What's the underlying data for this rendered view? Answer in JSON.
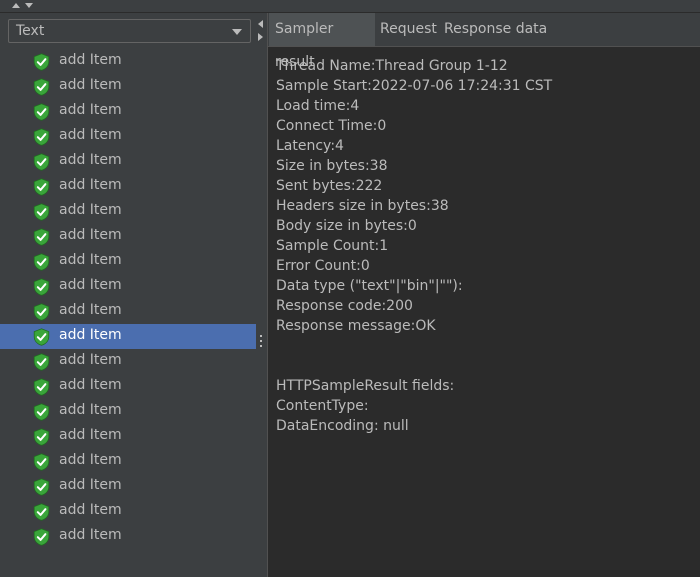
{
  "view_select": {
    "value": "Text"
  },
  "tree": {
    "items": [
      {
        "label": "add Item"
      },
      {
        "label": "add Item"
      },
      {
        "label": "add Item"
      },
      {
        "label": "add Item"
      },
      {
        "label": "add Item"
      },
      {
        "label": "add Item"
      },
      {
        "label": "add Item"
      },
      {
        "label": "add Item"
      },
      {
        "label": "add Item"
      },
      {
        "label": "add Item"
      },
      {
        "label": "add Item"
      },
      {
        "label": "add Item",
        "selected": true
      },
      {
        "label": "add Item"
      },
      {
        "label": "add Item"
      },
      {
        "label": "add Item"
      },
      {
        "label": "add Item"
      },
      {
        "label": "add Item"
      },
      {
        "label": "add Item"
      },
      {
        "label": "add Item"
      },
      {
        "label": "add Item"
      }
    ],
    "icon": "shield-check-icon"
  },
  "tabs": [
    {
      "label": "Sampler result",
      "active": true
    },
    {
      "label": "Request",
      "active": false
    },
    {
      "label": "Response data",
      "active": false
    }
  ],
  "sampler_result": {
    "lines": [
      "Thread Name:Thread Group 1-12",
      "Sample Start:2022-07-06 17:24:31 CST",
      "Load time:4",
      "Connect Time:0",
      "Latency:4",
      "Size in bytes:38",
      "Sent bytes:222",
      "Headers size in bytes:38",
      "Body size in bytes:0",
      "Sample Count:1",
      "Error Count:0",
      "Data type (\"text\"|\"bin\"|\"\"):",
      "Response code:200",
      "Response message:OK",
      "",
      "",
      "HTTPSampleResult fields:",
      "ContentType:",
      "DataEncoding: null"
    ]
  },
  "colors": {
    "background": "#3c3f41",
    "panel": "#2b2b2b",
    "selection": "#4b6eaf",
    "success_green": "#3aa53a"
  }
}
